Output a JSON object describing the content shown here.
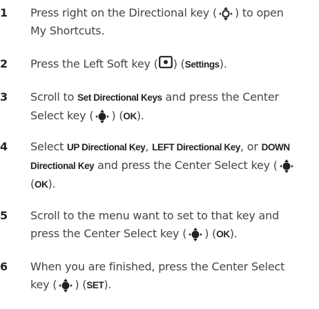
{
  "steps": [
    {
      "number": "1",
      "line1_a": "Press right on the Directional key (",
      "line1_b": ") to open",
      "line2": "My Shortcuts.",
      "icon": "navigation-key-icon"
    },
    {
      "number": "2",
      "a": "Press the Left Soft key (",
      "b": ") (",
      "bold": "Settings",
      "c": ").",
      "icon": "left-soft-key-icon"
    },
    {
      "number": "3",
      "a": "Scroll to ",
      "bold1": "Set Directional Keys",
      "b": " and press the Center",
      "c": "Select key (",
      "d": ") (",
      "bold2": "OK",
      "e": ").",
      "icon": "center-select-key-icon"
    },
    {
      "number": "4",
      "a": "Select ",
      "bold1": "UP Directional Key",
      "b": ", ",
      "bold2": "LEFT Directional Key",
      "c": ", or ",
      "bold3": "DOWN",
      "bold4": "Directional Key",
      "d": " and press the Center Select key (",
      "e": "(",
      "bold5": "OK",
      "f": ").",
      "icon": "center-select-key-icon"
    },
    {
      "number": "5",
      "a": "Scroll to the menu want to set to that key and",
      "b": "press the Center Select key (",
      "c": ") (",
      "bold": "OK",
      "d": ").",
      "icon": "center-select-key-icon"
    },
    {
      "number": "6",
      "a": "When you are finished, press the Center Select",
      "b": "key (",
      "c": ") (",
      "bold": "SET",
      "d": ").",
      "icon": "center-select-key-icon"
    }
  ]
}
